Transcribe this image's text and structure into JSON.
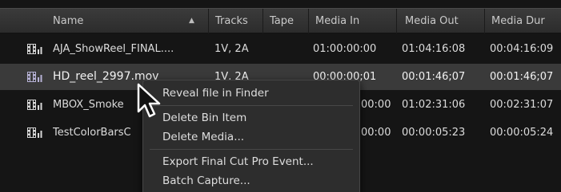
{
  "columns": [
    "Name",
    "Tracks",
    "Tape",
    "Media In",
    "Media Out",
    "Media Dur"
  ],
  "sort_icon": "triangle-up",
  "rows": [
    {
      "name": "AJA_ShowReel_FINAL....",
      "tracks": "1V, 2A",
      "tape": "",
      "media_in": "01:00:00:00",
      "media_out": "01:04:16:08",
      "media_dur": "00:04:16:09"
    },
    {
      "name": "HD_reel_2997.mov",
      "tracks": "1V, 2A",
      "tape": "",
      "media_in": "00:00:00;01",
      "media_out": "00:01:46;07",
      "media_dur": "00:01:46;07"
    },
    {
      "name": "MBOX_Smoke",
      "tracks": "",
      "tape": "",
      "media_in": "00:00",
      "media_out": "01:02:31:06",
      "media_dur": "00:02:31:07"
    },
    {
      "name": "TestColorBarsC",
      "tracks": "",
      "tape": "",
      "media_in": "00:00",
      "media_out": "00:00:05:23",
      "media_dur": "00:00:05:24"
    }
  ],
  "context_menu": {
    "reveal": "Reveal file in Finder",
    "delete_bin_item": "Delete Bin Item",
    "delete_media": "Delete Media...",
    "export_fcp": "Export Final Cut Pro Event...",
    "batch_capture": "Batch Capture..."
  },
  "colors": {
    "background": "#151515",
    "header": "#333333",
    "selected_row": "#3a3a3a",
    "menu": "#2d2d2d",
    "text": "#dcdcdc"
  },
  "icons": {
    "clip": "film-audio-clip-icon",
    "cursor": "arrow-cursor"
  }
}
